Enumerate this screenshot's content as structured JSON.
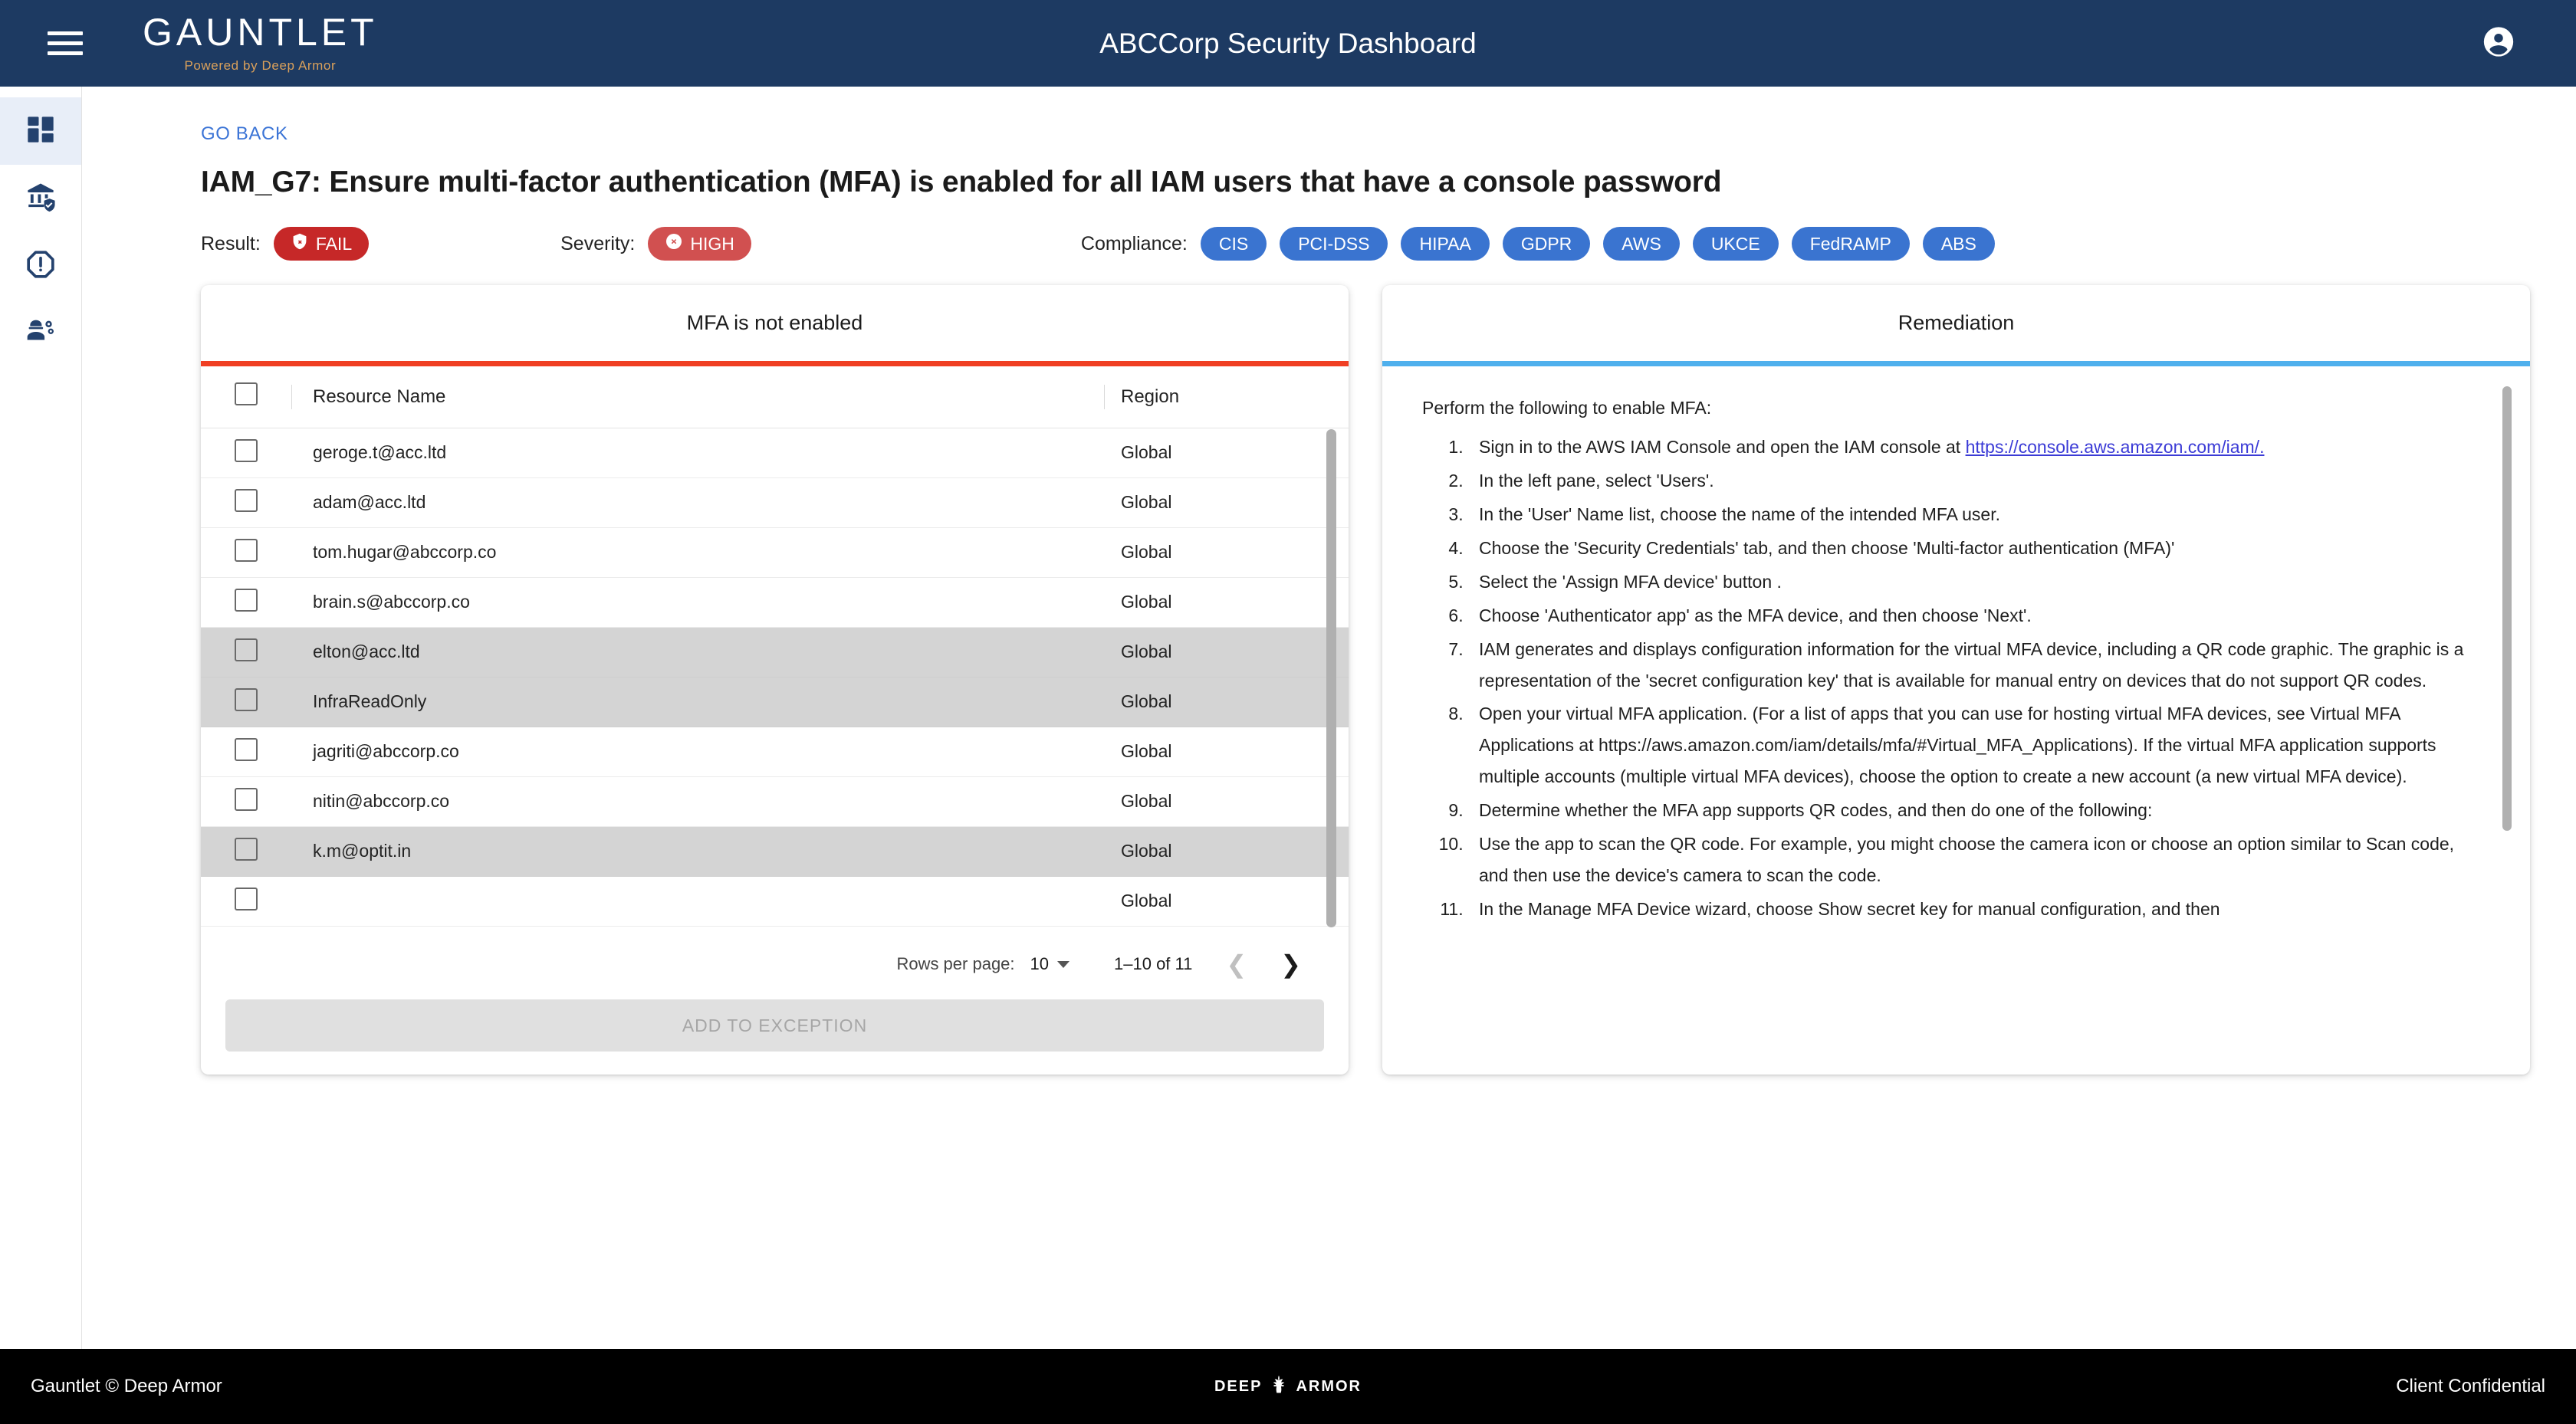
{
  "topbar": {
    "menu_icon": "hamburger-icon",
    "brand_name": "GAUNTLET",
    "brand_tagline": "Powered by Deep Armor",
    "title": "ABCCorp Security Dashboard",
    "account_icon": "account-circle-icon"
  },
  "sidebar": {
    "items": [
      {
        "icon": "dashboard-grid-icon",
        "active": true
      },
      {
        "icon": "bank-shield-icon",
        "active": false
      },
      {
        "icon": "alert-octagon-icon",
        "active": false
      },
      {
        "icon": "user-settings-icon",
        "active": false
      }
    ]
  },
  "page": {
    "go_back": "GO BACK",
    "title": "IAM_G7: Ensure multi-factor authentication (MFA) is enabled for all IAM users that have a console password",
    "result_label": "Result:",
    "result_value": "FAIL",
    "result_icon": "shield-x-icon",
    "result_color": "#c62828",
    "severity_label": "Severity:",
    "severity_value": "HIGH",
    "severity_icon": "circle-x-icon",
    "severity_color": "#d15050",
    "compliance_label": "Compliance:",
    "compliance_chips": [
      "CIS",
      "PCI-DSS",
      "HIPAA",
      "GDPR",
      "AWS",
      "UKCE",
      "FedRAMP",
      "ABS"
    ],
    "compliance_color": "#3a74d0"
  },
  "findings_card": {
    "title": "MFA is not enabled",
    "accent_color": "#f03f23",
    "columns": [
      "Resource Name",
      "Region"
    ],
    "rows": [
      {
        "name": "geroge.t@acc.ltd",
        "region": "Global",
        "highlighted": false
      },
      {
        "name": "adam@acc.ltd",
        "region": "Global",
        "highlighted": false
      },
      {
        "name": "tom.hugar@abccorp.co",
        "region": "Global",
        "highlighted": false
      },
      {
        "name": "brain.s@abccorp.co",
        "region": "Global",
        "highlighted": false
      },
      {
        "name": "elton@acc.ltd",
        "region": "Global",
        "highlighted": true
      },
      {
        "name": "InfraReadOnly",
        "region": "Global",
        "highlighted": true
      },
      {
        "name": "jagriti@abccorp.co",
        "region": "Global",
        "highlighted": false
      },
      {
        "name": "nitin@abccorp.co",
        "region": "Global",
        "highlighted": false
      },
      {
        "name": "k.m@optit.in",
        "region": "Global",
        "highlighted": true
      },
      {
        "name": "",
        "region": "Global",
        "highlighted": false
      }
    ],
    "pagination": {
      "rows_per_page_label": "Rows per page:",
      "rows_per_page_value": "10",
      "range": "1–10 of 11",
      "prev_icon": "chevron-left-icon",
      "next_icon": "chevron-right-icon"
    },
    "add_exception_label": "ADD TO EXCEPTION"
  },
  "remediation_card": {
    "title": "Remediation",
    "accent_color": "#4fb0ed",
    "intro": "Perform the following to enable MFA:",
    "steps": [
      "Sign in to the AWS IAM Console and open the IAM console at ",
      "In the left pane, select 'Users'.",
      "In the 'User' Name list, choose the name of the intended MFA user.",
      "Choose the 'Security Credentials' tab, and then choose 'Multi-factor authentication (MFA)'",
      "Select the 'Assign MFA device' button .",
      "Choose 'Authenticator app' as the MFA device, and then choose 'Next'.",
      "IAM generates and displays configuration information for the virtual MFA device, including a QR code graphic. The graphic is a representation of the 'secret configuration key' that is available for manual entry on devices that do not support QR codes.",
      "Open your virtual MFA application. (For a list of apps that you can use for hosting virtual MFA devices, see Virtual MFA Applications at https://aws.amazon.com/iam/details/mfa/#Virtual_MFA_Applications). If the virtual MFA application supports multiple accounts (multiple virtual MFA devices), choose the option to create a new account (a new virtual MFA device).",
      "Determine whether the MFA app supports QR codes, and then do one of the following:",
      "Use the app to scan the QR code. For example, you might choose the camera icon or choose an option similar to Scan code, and then use the device's camera to scan the code.",
      "In the Manage MFA Device wizard, choose Show secret key for manual configuration, and then"
    ],
    "step1_link": "https://console.aws.amazon.com/iam/."
  },
  "footer": {
    "left": "Gauntlet © Deep Armor",
    "logo_left": "DEEP",
    "logo_right": "ARMOR",
    "right": "Client Confidential"
  }
}
